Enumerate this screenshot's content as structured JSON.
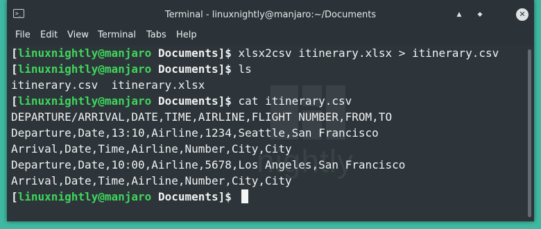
{
  "window": {
    "title": "Terminal - linuxnightly@manjaro:~/Documents",
    "app_icon": ">_",
    "buttons": {
      "minimize": "▲",
      "maximize": "◆",
      "close": "✕"
    }
  },
  "menu": [
    "File",
    "Edit",
    "View",
    "Terminal",
    "Tabs",
    "Help"
  ],
  "prompt": {
    "open": "[",
    "user_host": "linuxnightly@manjaro",
    "dir": "Documents",
    "close": "]$ "
  },
  "lines": [
    {
      "type": "prompt",
      "command": "xlsx2csv itinerary.xlsx > itinerary.csv"
    },
    {
      "type": "prompt",
      "command": "ls"
    },
    {
      "type": "output",
      "text": "itinerary.csv  itinerary.xlsx"
    },
    {
      "type": "prompt",
      "command": "cat itinerary.csv"
    },
    {
      "type": "output",
      "text": "DEPARTURE/ARRIVAL,DATE,TIME,AIRLINE,FLIGHT NUMBER,FROM,TO"
    },
    {
      "type": "output",
      "text": "Departure,Date,13:10,Airline,1234,Seattle,San Francisco"
    },
    {
      "type": "output",
      "text": "Arrival,Date,Time,Airline,Number,City,City"
    },
    {
      "type": "output",
      "text": "Departure,Date,10:00,Airline,5678,Los Angeles,San Francisco"
    },
    {
      "type": "output",
      "text": "Arrival,Date,Time,Airline,Number,City,City"
    },
    {
      "type": "prompt",
      "command": "",
      "cursor": true
    }
  ],
  "watermark": {
    "text": "nightly"
  },
  "colors": {
    "prompt_user": "#3fd65c",
    "background": "#2d353a",
    "desktop": "#3fb9a1"
  }
}
